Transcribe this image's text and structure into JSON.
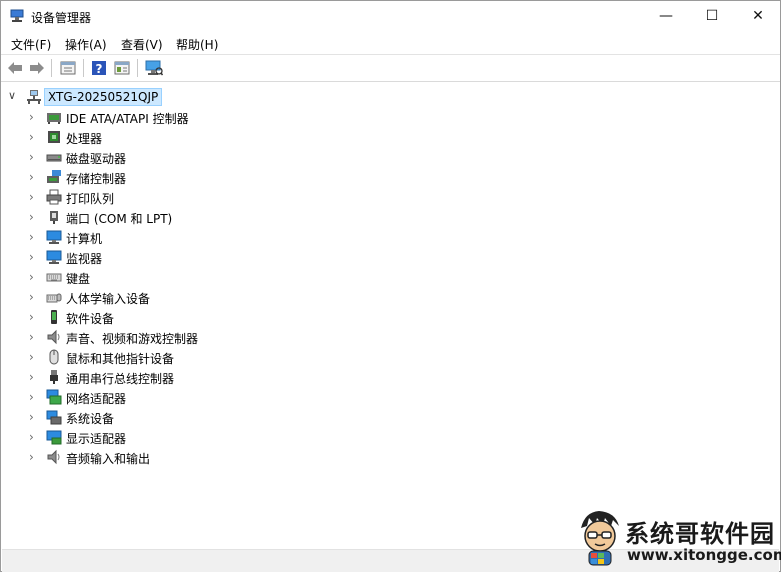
{
  "window": {
    "title": "设备管理器",
    "minimize": "—",
    "maximize": "☐",
    "close": "✕"
  },
  "menu": [
    {
      "label": "文件(F)"
    },
    {
      "label": "操作(A)"
    },
    {
      "label": "查看(V)"
    },
    {
      "label": "帮助(H)"
    }
  ],
  "toolbar": {
    "items": [
      "back-icon",
      "forward-icon",
      "properties-icon",
      "help-icon",
      "view-icon",
      "scan-hardware-icon"
    ]
  },
  "tree": {
    "root": {
      "label": "XTG-20250521QJP",
      "expand": "∨",
      "icon": "computer-icon"
    },
    "expand_glyph": "›",
    "items": [
      {
        "label": "IDE ATA/ATAPI 控制器",
        "icon": "ide-controller-icon"
      },
      {
        "label": "处理器",
        "icon": "processor-icon"
      },
      {
        "label": "磁盘驱动器",
        "icon": "disk-drive-icon"
      },
      {
        "label": "存储控制器",
        "icon": "storage-controller-icon"
      },
      {
        "label": "打印队列",
        "icon": "printer-icon"
      },
      {
        "label": "端口 (COM 和 LPT)",
        "icon": "port-icon"
      },
      {
        "label": "计算机",
        "icon": "monitor-icon"
      },
      {
        "label": "监视器",
        "icon": "monitor-icon"
      },
      {
        "label": "键盘",
        "icon": "keyboard-icon"
      },
      {
        "label": "人体学输入设备",
        "icon": "hid-icon"
      },
      {
        "label": "软件设备",
        "icon": "software-device-icon"
      },
      {
        "label": "声音、视频和游戏控制器",
        "icon": "speaker-icon"
      },
      {
        "label": "鼠标和其他指针设备",
        "icon": "mouse-icon"
      },
      {
        "label": "通用串行总线控制器",
        "icon": "usb-icon"
      },
      {
        "label": "网络适配器",
        "icon": "network-icon"
      },
      {
        "label": "系统设备",
        "icon": "system-device-icon"
      },
      {
        "label": "显示适配器",
        "icon": "display-adapter-icon"
      },
      {
        "label": "音频输入和输出",
        "icon": "speaker-icon"
      }
    ]
  },
  "watermark": {
    "name": "系统哥软件园",
    "url": "www.xitongge.com"
  },
  "colors": {
    "selection_bg": "#cce8ff",
    "selection_border": "#99d1ff",
    "accent": "#0078d7"
  }
}
